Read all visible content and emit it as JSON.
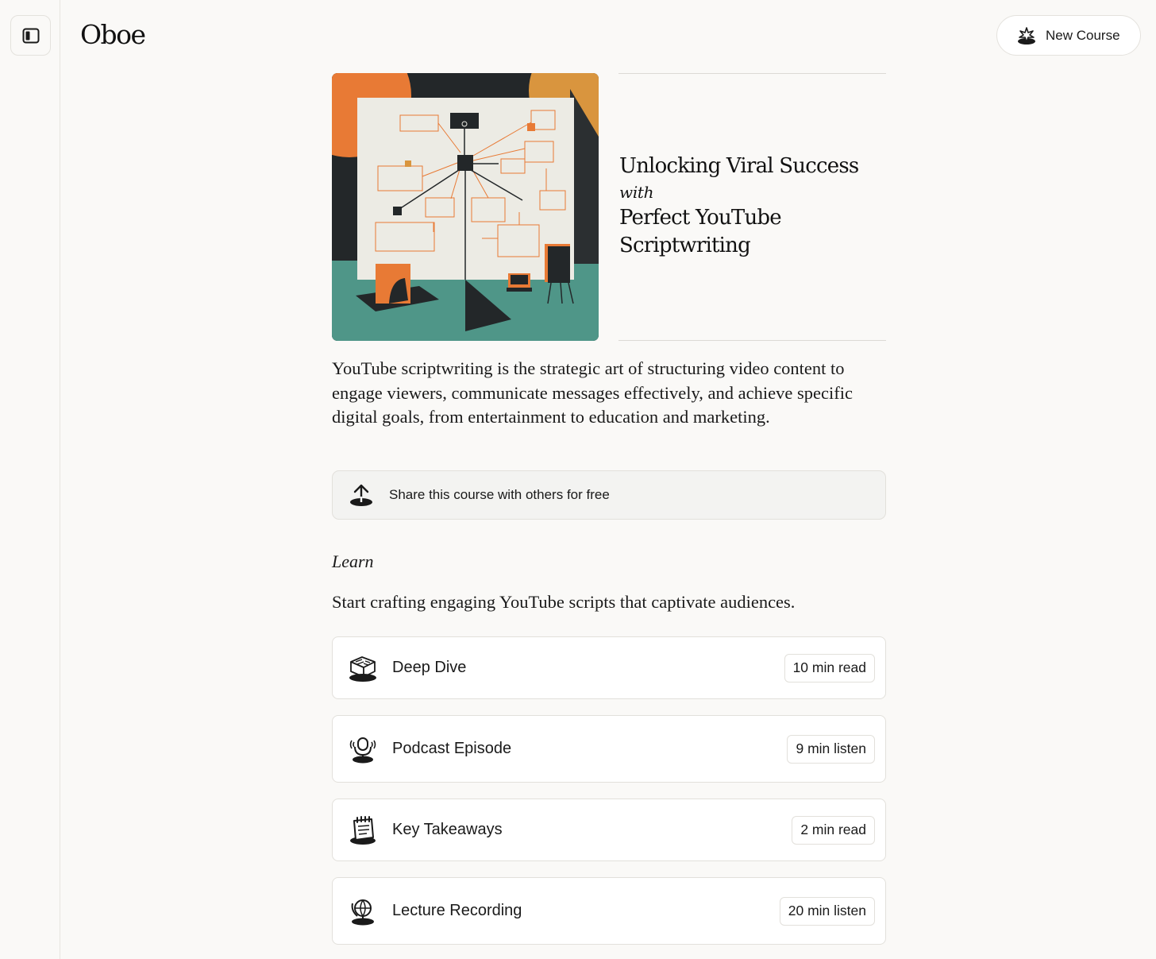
{
  "app": {
    "logo": "Oboe"
  },
  "header": {
    "new_course_label": "New Course"
  },
  "course": {
    "title_line1": "Unlocking Viral Success",
    "title_with": "with",
    "title_line2": "Perfect YouTube Scriptwriting",
    "description": "YouTube scriptwriting is the strategic art of structuring video content to engage viewers, communicate messages effectively, and achieve specific digital goals, from entertainment to education and marketing."
  },
  "share": {
    "label": "Share this course with others for free"
  },
  "learn": {
    "heading": "Learn",
    "subtitle": "Start crafting engaging YouTube scripts that captivate audiences.",
    "items": [
      {
        "label": "Deep Dive",
        "duration": "10 min read",
        "icon": "book-icon"
      },
      {
        "label": "Podcast Episode",
        "duration": "9 min listen",
        "icon": "microphone-icon"
      },
      {
        "label": "Key Takeaways",
        "duration": "2 min read",
        "icon": "notepad-icon"
      },
      {
        "label": "Lecture Recording",
        "duration": "20 min listen",
        "icon": "globe-icon"
      }
    ]
  },
  "colors": {
    "background": "#faf9f7",
    "accent_orange": "#e87a35",
    "accent_teal": "#4f9688",
    "dark": "#222629"
  }
}
